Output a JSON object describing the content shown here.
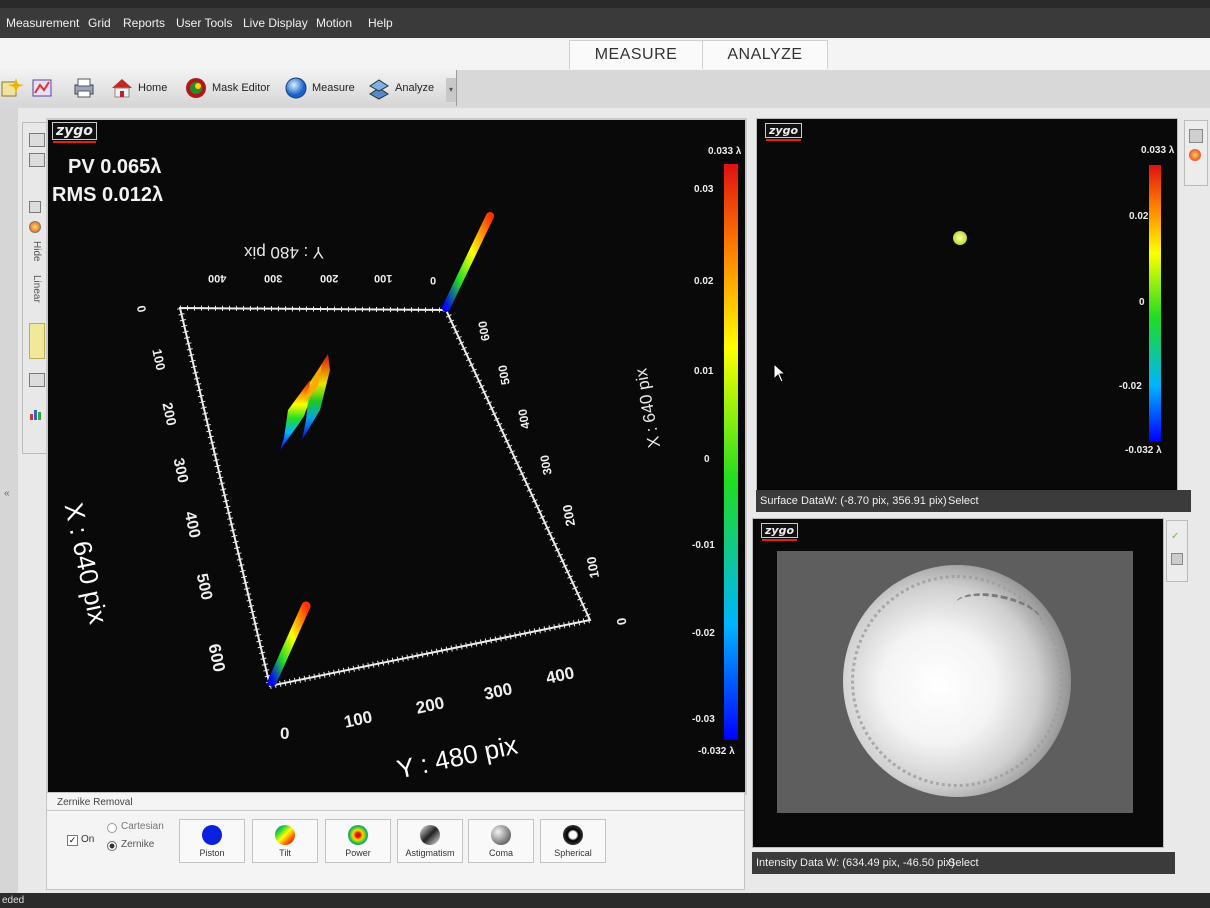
{
  "menu": [
    "Measurement",
    "Grid",
    "Reports",
    "User Tools",
    "Live Display",
    "Motion",
    "Help"
  ],
  "tabs": {
    "measure": "MEASURE",
    "analyze": "ANALYZE"
  },
  "toolbar": {
    "home": "Home",
    "mask_editor": "Mask Editor",
    "measure": "Measure",
    "analyze": "Analyze"
  },
  "side_tools": {
    "hide": "Hide",
    "linear": "Linear"
  },
  "plot3d": {
    "logo": "zygo",
    "pv": "PV 0.065λ",
    "rms": "RMS 0.012λ",
    "axis_x": "X : 640 pix",
    "axis_x_back": "X : 640 pix",
    "axis_y": "Y : 480 pix",
    "axis_y_back": "Y : 480 pix",
    "x_ticks": [
      "0",
      "100",
      "200",
      "300",
      "400",
      "500",
      "600"
    ],
    "y_ticks": [
      "0",
      "100",
      "200",
      "300",
      "400"
    ],
    "back_y_ticks": [
      "400",
      "300",
      "200",
      "100",
      "0"
    ],
    "back_x_ticks": [
      "600",
      "500",
      "400",
      "300",
      "200",
      "100",
      "0"
    ],
    "colorbar_max": "0.033 λ",
    "colorbar_min": "-0.032 λ",
    "colorbar_ticks": [
      "0.03",
      "0.02",
      "0.01",
      "0",
      "-0.01",
      "-0.02",
      "-0.03"
    ]
  },
  "zernike": {
    "title": "Zernike Removal",
    "on_label": "On",
    "on_checked": true,
    "cartesian": "Cartesian",
    "zernike": "Zernike",
    "selected_mode": "Zernike",
    "buttons": [
      "Piston",
      "Tilt",
      "Power",
      "Astigmatism",
      "Coma",
      "Spherical"
    ]
  },
  "surface": {
    "logo": "zygo",
    "colorbar_max": "0.033 λ",
    "colorbar_min": "-0.032 λ",
    "ticks": [
      "0.02",
      "0",
      "-0.02"
    ],
    "status_label": "Surface Data",
    "status_coords": "W: (-8.70 pix, 356.91 pix)",
    "status_mode": "Select"
  },
  "intensity": {
    "logo": "zygo",
    "status_label": "Intensity Data",
    "status_coords": "W: (634.49 pix, -46.50 pix)",
    "status_mode": "Select"
  },
  "statusbar": {
    "text": "eded"
  },
  "colors": {
    "accent_red": "#d42020",
    "plot_bg": "#090909",
    "panel_border": "#c9c9c9"
  }
}
